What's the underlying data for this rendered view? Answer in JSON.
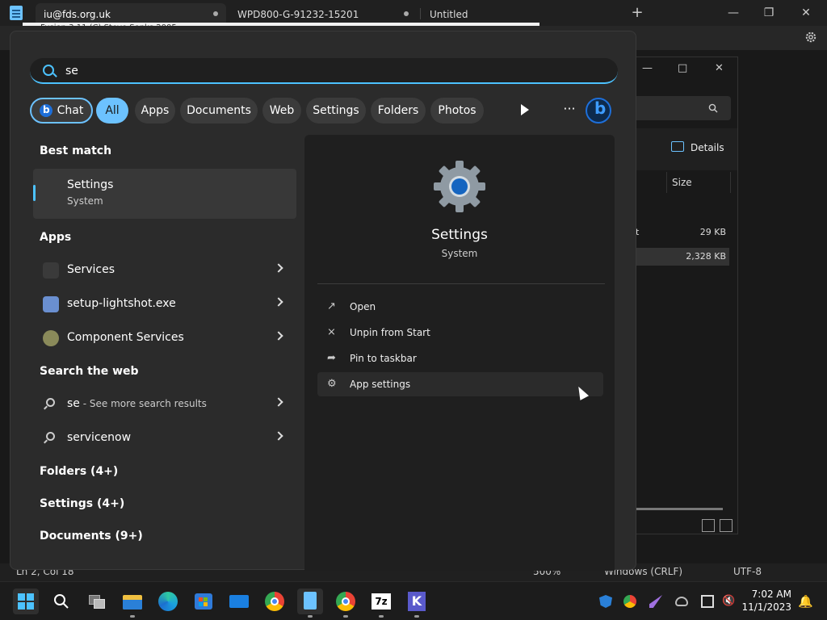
{
  "notepad": {
    "tabs": [
      "iu@fds.org.uk",
      "WPD800-G-91232-15201",
      "Untitled"
    ],
    "new_tab": "+",
    "dialog_text": "Fusion 3.11 (C) Steve Sonks 2005",
    "status": {
      "position": "Ln 2, Col 18",
      "zoom": "500%",
      "line_ending": "Windows (CRLF)",
      "encoding": "UTF-8"
    }
  },
  "explorer": {
    "details_label": "Details",
    "col_size": "Size",
    "rows": [
      {
        "name": "t",
        "size": "29 KB"
      },
      {
        "name": "",
        "size": "2,328 KB"
      }
    ]
  },
  "search": {
    "query": "se",
    "chips": [
      "Chat",
      "All",
      "Apps",
      "Documents",
      "Web",
      "Settings",
      "Folders",
      "Photos"
    ],
    "more": "···",
    "sections": {
      "best_match": "Best match",
      "apps": "Apps",
      "web": "Search the web",
      "folders": "Folders (4+)",
      "settings": "Settings (4+)",
      "documents": "Documents (9+)"
    },
    "best_match": {
      "title": "Settings",
      "subtitle": "System"
    },
    "apps": [
      "Services",
      "setup-lightshot.exe",
      "Component Services"
    ],
    "web": [
      {
        "term": "se",
        "suffix": " - See more search results"
      },
      {
        "term": "servicenow",
        "suffix": ""
      }
    ],
    "detail": {
      "title": "Settings",
      "subtitle": "System",
      "actions": [
        "Open",
        "Unpin from Start",
        "Pin to taskbar",
        "App settings"
      ]
    }
  },
  "taskbar": {
    "time": "7:02 AM",
    "date": "11/1/2023"
  },
  "colors": {
    "accent": "#4cc2ff",
    "chip_active": "#6cc2ff",
    "panel": "#2b2b2b"
  }
}
